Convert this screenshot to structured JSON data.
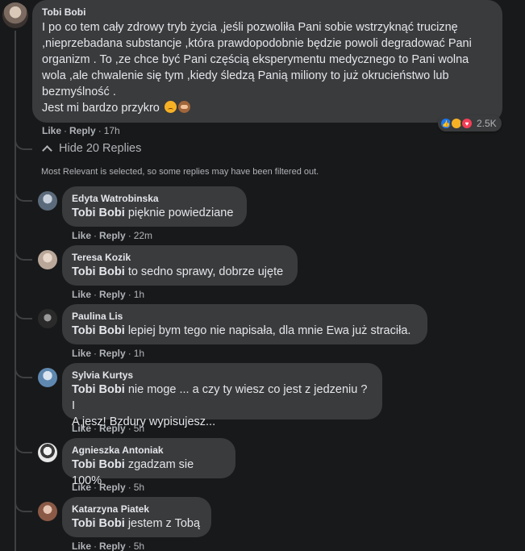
{
  "main_comment": {
    "author": "Tobi Bobi",
    "lines": [
      "I po co tem cały zdrowy tryb życia ,jeśli pozwoliła Pani sobie wstrzyknąć truciznę",
      ",nieprzebadana substancje ,która prawdopodobnie będzie powoli degradować Pani",
      "organizm . To ,ze chce być Pani częścią eksperymentu medycznego to Pani wolna",
      "wola ,ale chwalenie się tym ,kiedy śledzą Panią miliony to już okrucieństwo lub",
      "bezmyślność .",
      "Jest mi bardzo przykro"
    ],
    "like": "Like",
    "reply": "Reply",
    "time": "17h",
    "reaction_count": "2.5K",
    "reaction_icons": [
      "like-icon",
      "haha-icon",
      "love-icon"
    ]
  },
  "hide_replies": "Hide 20 Replies",
  "filter_note": "Most Relevant is selected, so some replies may have been filtered out.",
  "replies": [
    {
      "author": "Edyta Watrobinska",
      "tag": "Tobi Bobi",
      "lines": [
        "pięknie powiedziane"
      ],
      "like": "Like",
      "reply": "Reply",
      "time": "22m"
    },
    {
      "author": "Teresa Kozik",
      "tag": "Tobi Bobi",
      "lines": [
        "to sedno sprawy, dobrze ujęte"
      ],
      "like": "Like",
      "reply": "Reply",
      "time": "1h"
    },
    {
      "author": "Paulina Lis",
      "tag": "Tobi Bobi",
      "lines": [
        "lepiej bym tego nie napisała, dla mnie Ewa już straciła."
      ],
      "like": "Like",
      "reply": "Reply",
      "time": "1h"
    },
    {
      "author": "Sylvia Kurtys",
      "tag": "Tobi Bobi",
      "lines": [
        "nie moge ... a czy ty wiesz co jest z jedzeniu ? I",
        "A jesz! Bzdury wypisujesz..."
      ],
      "like": "Like",
      "reply": "Reply",
      "time": "5h"
    },
    {
      "author": "Agnieszka Antoniak",
      "tag": "Tobi Bobi",
      "lines": [
        "zgadzam sie 100%"
      ],
      "like": "Like",
      "reply": "Reply",
      "time": "5h"
    },
    {
      "author": "Katarzyna Piatek",
      "tag": "Tobi Bobi",
      "lines": [
        "jestem z Tobą"
      ],
      "like": "Like",
      "reply": "Reply",
      "time": "5h"
    }
  ]
}
